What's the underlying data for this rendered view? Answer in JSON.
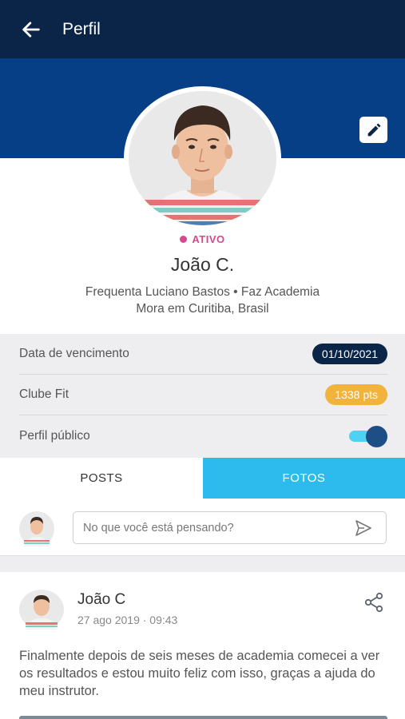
{
  "appbar": {
    "title": "Perfil",
    "back_icon": "arrow-left-icon"
  },
  "profile": {
    "edit_icon": "pencil-icon",
    "status": "ATIVO",
    "name": "João C.",
    "info_line1": "Frequenta Luciano Bastos • Faz Academia",
    "info_line2": "Mora em Curitiba, Brasil"
  },
  "details": {
    "rows": [
      {
        "label": "Data de vencimento",
        "value": "01/10/2021"
      },
      {
        "label": "Clube Fit",
        "value": "1338 pts"
      },
      {
        "label": "Perfil público",
        "toggle_on": true
      }
    ]
  },
  "tabs": [
    {
      "label": "POSTS",
      "active": false
    },
    {
      "label": "FOTOS",
      "active": true
    }
  ],
  "composer": {
    "placeholder": "No que você está pensando?",
    "send_icon": "send-icon"
  },
  "post": {
    "author": "João C",
    "timestamp": "27 ago 2019 · 09:43",
    "text": "Finalmente depois de seis meses de academia comecei a ver os resultados e estou muito feliz com isso, graças a ajuda do meu instrutor.",
    "share_icon": "share-icon"
  },
  "colors": {
    "appbar": "#0a2547",
    "banner": "#063f85",
    "status": "#d6478e",
    "date_pill": "#0a2547",
    "points_pill": "#f2b33d",
    "active_tab": "#2dbbee",
    "toggle_track": "#4fd1f4",
    "toggle_knob": "#1d4f86"
  }
}
